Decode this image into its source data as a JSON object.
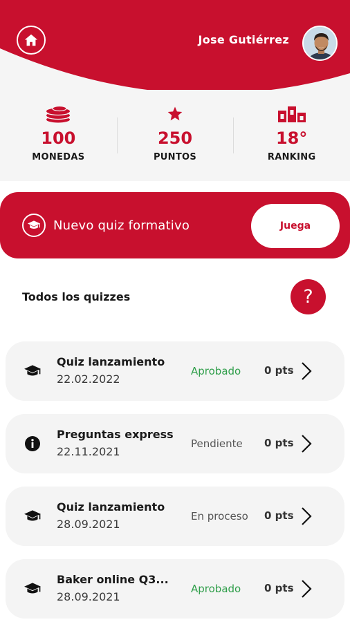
{
  "header": {
    "user_name": "Jose Gutiérrez",
    "home_icon": "home-icon",
    "avatar": "user-avatar",
    "brand_color": "#c8102e"
  },
  "stats": [
    {
      "icon": "coins-icon",
      "value": "100",
      "label": "MONEDAS"
    },
    {
      "icon": "star-icon",
      "value": "250",
      "label": "PUNTOS"
    },
    {
      "icon": "podium-icon",
      "value": "18°",
      "label": "RANKING"
    }
  ],
  "banner": {
    "icon": "graduation-cap-icon",
    "title": "Nuevo quiz formativo",
    "button_label": "Juega"
  },
  "section": {
    "title": "Todos los quizzes",
    "help_label": "?"
  },
  "quizzes": [
    {
      "icon": "graduation-cap-icon",
      "title": "Quiz lanzamiento",
      "date": "22.02.2022",
      "status": "Aprobado",
      "status_color": "#2f9e4a",
      "points": "0 pts"
    },
    {
      "icon": "info-icon",
      "title": "Preguntas express",
      "date": "22.11.2021",
      "status": "Pendiente",
      "status_color": "#555555",
      "points": "0 pts"
    },
    {
      "icon": "graduation-cap-icon",
      "title": "Quiz lanzamiento",
      "date": "28.09.2021",
      "status": "En proceso",
      "status_color": "#555555",
      "points": "0 pts"
    },
    {
      "icon": "graduation-cap-icon",
      "title": "Baker online Q3...",
      "date": "28.09.2021",
      "status": "Aprobado",
      "status_color": "#2f9e4a",
      "points": "0 pts"
    }
  ]
}
